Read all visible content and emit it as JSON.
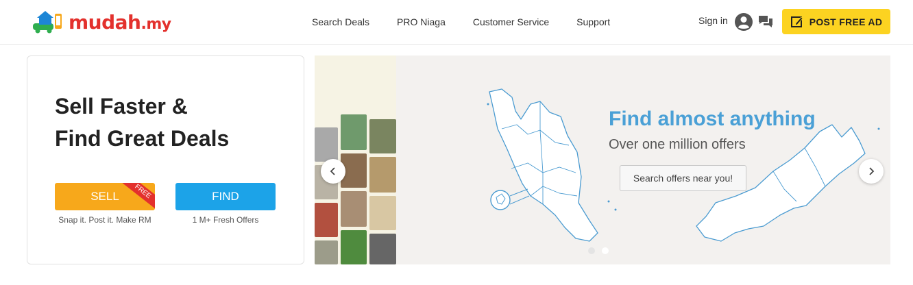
{
  "header": {
    "logo": {
      "name": "mudah",
      "tld": ".my"
    },
    "nav": [
      {
        "label": "Search Deals"
      },
      {
        "label": "PRO Niaga"
      },
      {
        "label": "Customer Service"
      },
      {
        "label": "Support"
      }
    ],
    "signin_label": "Sign in",
    "user_icon": "user-circle-icon",
    "chat_icon": "chat-bubbles-icon",
    "post_ad_label": "POST FREE AD",
    "post_ad_icon": "edit-icon"
  },
  "promo": {
    "headline_line1": "Sell Faster &",
    "headline_line2": "Find Great Deals",
    "sell": {
      "label": "SELL",
      "ribbon": "FREE",
      "caption": "Snap it. Post it. Make RM"
    },
    "find": {
      "label": "FIND",
      "caption": "1 M+ Fresh Offers"
    }
  },
  "banner": {
    "title": "Find almost anything",
    "subtitle": "Over one million offers",
    "button_label": "Search offers near you!",
    "prev_icon": "chevron-left-icon",
    "next_icon": "chevron-right-icon",
    "slides_total": 2,
    "active_slide": 2
  },
  "colors": {
    "brand_red": "#e3312d",
    "post_ad_yellow": "#fcd321",
    "sell_orange": "#f7a81b",
    "find_blue": "#1ca3e8",
    "banner_title_blue": "#4aa0d6"
  }
}
